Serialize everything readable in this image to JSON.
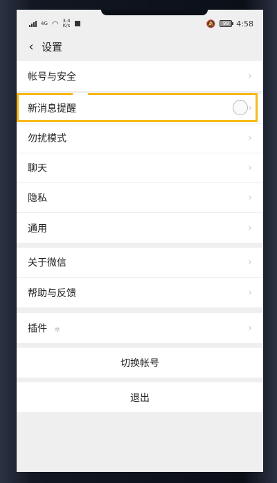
{
  "status_bar": {
    "network": "4G",
    "speed": "3.4",
    "speed_unit": "K/s",
    "battery": "99",
    "time": "4:58"
  },
  "header": {
    "title": "设置"
  },
  "groups": {
    "account": {
      "items": [
        "帐号与安全"
      ]
    },
    "main": {
      "items": [
        "新消息提醒",
        "勿扰模式",
        "聊天",
        "隐私",
        "通用"
      ]
    },
    "about": {
      "items": [
        "关于微信",
        "帮助与反馈"
      ]
    },
    "plugins": {
      "items": [
        "插件"
      ]
    }
  },
  "actions": {
    "switch_account": "切换帐号",
    "logout": "退出"
  },
  "icons": {
    "back": "chevron-left-icon",
    "chevron": "chevron-right-icon",
    "plugin": "settings-gear-icon"
  },
  "colors": {
    "highlight": "#f6b916",
    "background": "#efefef",
    "row": "#ffffff"
  }
}
